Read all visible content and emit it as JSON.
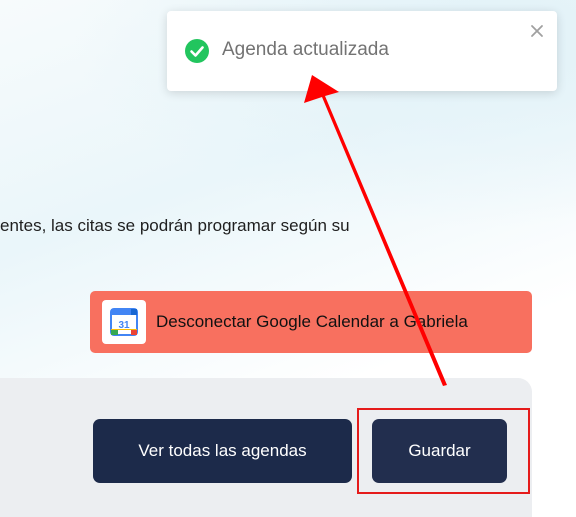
{
  "toast": {
    "message": "Agenda actualizada",
    "status_color": "#22c55e",
    "icon": "check-circle-icon",
    "close_icon": "close-icon"
  },
  "description": {
    "text": "entes, las citas se podrán programar según su"
  },
  "google_calendar_button": {
    "label": "Desconectar Google Calendar a Gabriela",
    "logo_text": "31",
    "background_color": "#f8705f",
    "icon": "google-calendar-icon"
  },
  "actions": {
    "view_all_label": "Ver todas las agendas",
    "save_label": "Guardar",
    "button_color": "#1c2a4a"
  },
  "annotations": {
    "arrow_color": "#ff0000",
    "highlight_color": "#e51b1b"
  }
}
